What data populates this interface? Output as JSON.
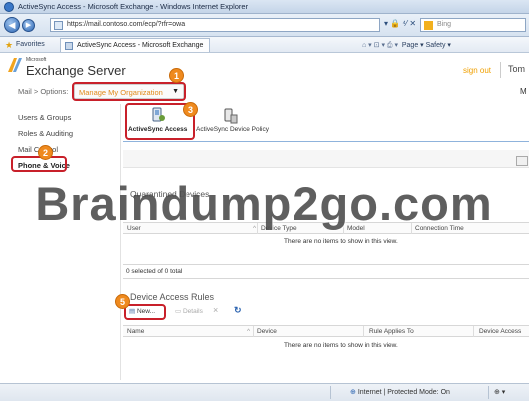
{
  "browser": {
    "window_title": "ActiveSync Access - Microsoft Exchange - Windows Internet Explorer",
    "url": "https://mail.contoso.com/ecp/?rfr=owa",
    "search_placeholder": "Bing",
    "favorites_label": "Favorites",
    "tab_label": "ActiveSync Access - Microsoft Exchange",
    "command_bar": "Page ▾   Safety ▾",
    "status_text": "Internet | Protected Mode: On",
    "zoom_text": "⊕ ▾"
  },
  "header": {
    "logo_small": "Microsoft",
    "title": "Exchange Server",
    "signout": "sign out",
    "user": "Tom"
  },
  "breadcrumb": {
    "mail": "Mail",
    "separator": ">",
    "options": "Options:",
    "org_select": "Manage My Organization",
    "right_label": "M"
  },
  "nav": {
    "items": [
      "Users & Groups",
      "Roles & Auditing",
      "Mail Control",
      "Phone & Voice"
    ],
    "selected": "Phone & Voice"
  },
  "tabs": {
    "activesync_access": "ActiveSync Access",
    "activesync_policy": "ActiveSync Device Policy"
  },
  "quarantine": {
    "title": "Quarantined Devices",
    "columns": [
      "User",
      "Device Type",
      "Model",
      "Connection Time"
    ],
    "empty": "There are no items to show in this view.",
    "count": "0 selected of 0 total"
  },
  "rules": {
    "title": "Device Access Rules",
    "new": "New...",
    "details": "Details",
    "delete": "×",
    "refresh": "↻",
    "columns": [
      "Name",
      "Device",
      "Rule Applies To",
      "Device Access"
    ],
    "empty": "There are no items to show in this view."
  },
  "callouts": {
    "one": "1",
    "two": "2",
    "three": "3",
    "five": "5"
  },
  "watermark": "Braindump2go.com",
  "colors": {
    "callout_border": "#c8202a",
    "badge": "#ef8a1e",
    "link_orange": "#e08a1a"
  }
}
